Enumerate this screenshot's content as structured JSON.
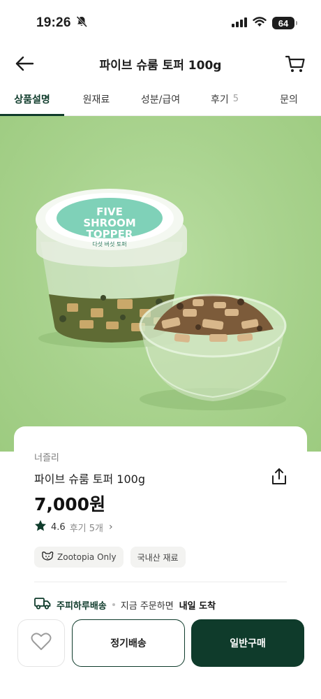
{
  "status_bar": {
    "time": "19:26",
    "battery": "64",
    "icons": [
      "bell-slash-icon",
      "signal-icon",
      "wifi-icon",
      "battery-icon"
    ]
  },
  "header": {
    "title": "파이브 슈룸 토퍼 100g",
    "back_icon": "arrow-left-icon",
    "cart_icon": "cart-icon"
  },
  "tabs": [
    {
      "label": "상품설명",
      "active": true
    },
    {
      "label": "원재료",
      "active": false
    },
    {
      "label": "성분/급여",
      "active": false
    },
    {
      "label": "후기",
      "count": "5",
      "active": false
    },
    {
      "label": "문의",
      "active": false
    }
  ],
  "hero": {
    "lid_lines": [
      "FIVE",
      "SHROOM",
      "TOPPER"
    ],
    "lid_sub": "다섯 버섯 토퍼",
    "background_color": "#a8d28d"
  },
  "product": {
    "brand": "너즐리",
    "name": "파이브 슈룸 토퍼 100g",
    "price": "7,000원",
    "rating": "4.6",
    "reviews": "후기 5개",
    "tags": [
      {
        "label": "Zootopia Only",
        "icon": "dog-icon"
      },
      {
        "label": "국내산 재료"
      }
    ],
    "delivery": {
      "label": "주피하루배송",
      "text": "지금 주문하면",
      "strong": "내일 도착"
    }
  },
  "bottom_bar": {
    "subscribe_label": "정기배송",
    "buy_label": "일반구매"
  },
  "colors": {
    "brand_dark_green": "#0f3b2b",
    "hero_green": "#a8d28d"
  }
}
